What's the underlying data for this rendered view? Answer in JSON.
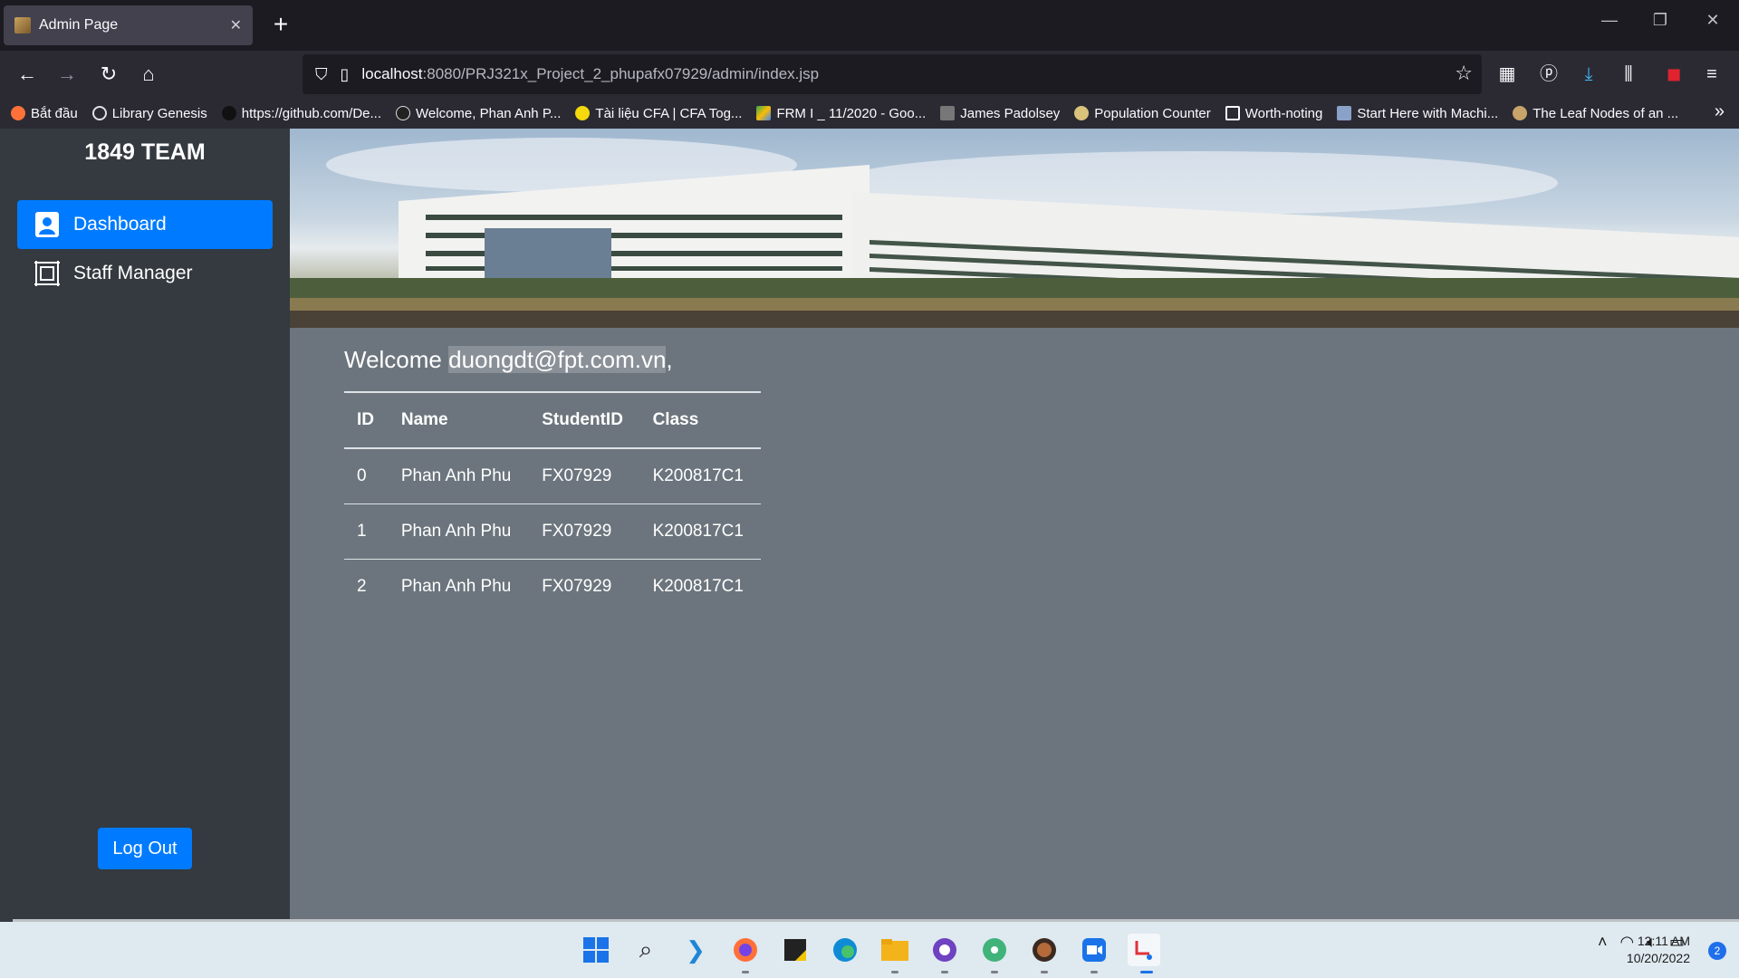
{
  "browser": {
    "tab_title": "Admin Page",
    "url_host": "localhost",
    "url_path": ":8080/PRJ321x_Project_2_phupafx07929/admin/index.jsp",
    "bookmarks": [
      {
        "label": "Bắt đầu",
        "color": "#ff7139"
      },
      {
        "label": "Library Genesis",
        "color": "#e0e0e6"
      },
      {
        "label": "https://github.com/De...",
        "color": "#111111"
      },
      {
        "label": "Welcome, Phan Anh P...",
        "color": "#222222"
      },
      {
        "label": "Tài liệu CFA | CFA Tog...",
        "color": "#f5d90a"
      },
      {
        "label": "FRM I _ 11/2020 - Goo...",
        "color": "#34a853"
      },
      {
        "label": "James Padolsey",
        "color": "#777777"
      },
      {
        "label": "Population Counter",
        "color": "#d9c27a"
      },
      {
        "label": "Worth-noting",
        "color": "#2b2a33"
      },
      {
        "label": "Start Here with Machi...",
        "color": "#8aa2c8"
      },
      {
        "label": "The Leaf Nodes of an ...",
        "color": "#c8a36a"
      }
    ]
  },
  "sidebar": {
    "brand": "1849 TEAM",
    "items": [
      {
        "label": "Dashboard",
        "active": true
      },
      {
        "label": "Staff Manager",
        "active": false
      }
    ],
    "logout": "Log Out"
  },
  "main": {
    "welcome_prefix": "Welcome ",
    "welcome_email": "duongdt@fpt.com.vn",
    "welcome_suffix": ",",
    "table": {
      "headers": [
        "ID",
        "Name",
        "StudentID",
        "Class"
      ],
      "rows": [
        [
          "0",
          "Phan Anh Phu",
          "FX07929",
          "K200817C1"
        ],
        [
          "1",
          "Phan Anh Phu",
          "FX07929",
          "K200817C1"
        ],
        [
          "2",
          "Phan Anh Phu",
          "FX07929",
          "K200817C1"
        ]
      ]
    }
  },
  "taskbar": {
    "time": "12:11 AM",
    "date": "10/20/2022",
    "notifications": "2"
  },
  "colors": {
    "accent": "#007bff",
    "sidebar_bg": "#343a40",
    "content_bg": "#6c757d"
  }
}
